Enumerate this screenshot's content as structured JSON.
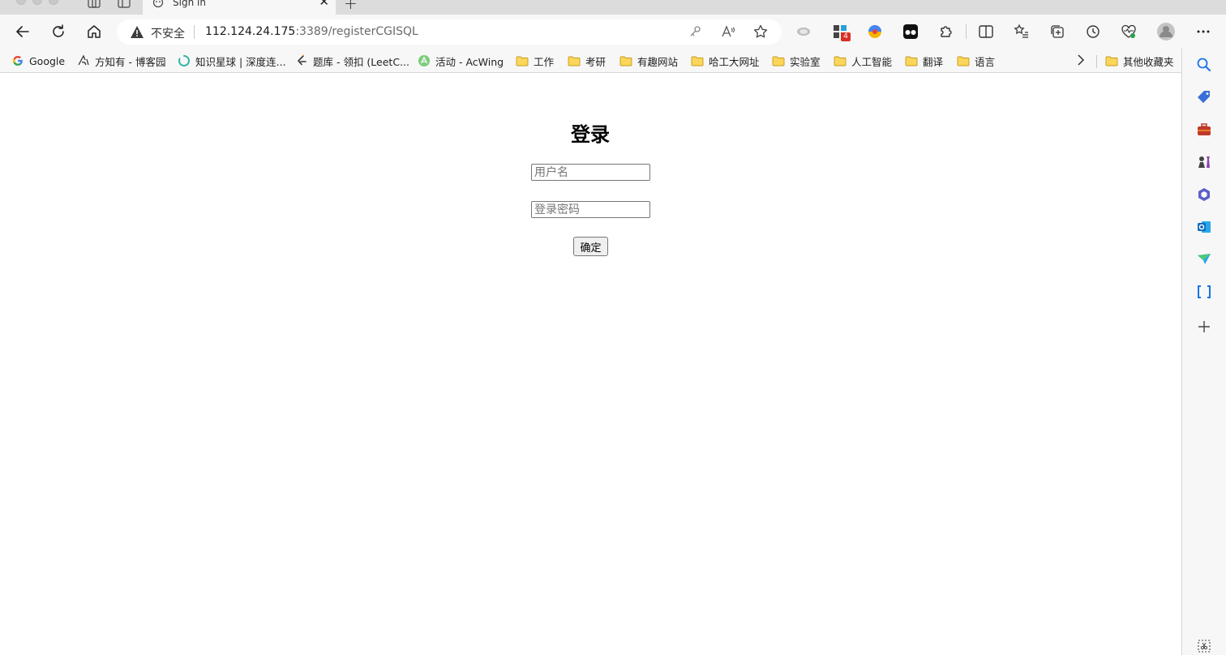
{
  "tab": {
    "title": "Sign in"
  },
  "address_bar": {
    "security_label": "不安全",
    "url_host": "112.124.24.175",
    "url_rest": ":3389/registerCGISQL"
  },
  "extensions": {
    "badge_count": "4"
  },
  "bookmarks": [
    {
      "label": "Google",
      "icon": "google-icon"
    },
    {
      "label": "方知有 - 博客园",
      "icon": "site-icon"
    },
    {
      "label": "知识星球 | 深度连...",
      "icon": "site-icon"
    },
    {
      "label": "题库 - 领扣 (LeetC...",
      "icon": "leetcode-icon"
    },
    {
      "label": "活动 - AcWing",
      "icon": "acwing-icon"
    },
    {
      "label": "工作",
      "icon": "folder-icon"
    },
    {
      "label": "考研",
      "icon": "folder-icon"
    },
    {
      "label": "有趣网站",
      "icon": "folder-icon"
    },
    {
      "label": "哈工大网址",
      "icon": "folder-icon"
    },
    {
      "label": "实验室",
      "icon": "folder-icon"
    },
    {
      "label": "人工智能",
      "icon": "folder-icon"
    },
    {
      "label": "翻译",
      "icon": "folder-icon"
    },
    {
      "label": "语言",
      "icon": "folder-icon"
    }
  ],
  "other_bookmarks": {
    "label": "其他收藏夹"
  },
  "login": {
    "title": "登录",
    "username_placeholder": "用户名",
    "password_placeholder": "登录密码",
    "submit_label": "确定"
  }
}
